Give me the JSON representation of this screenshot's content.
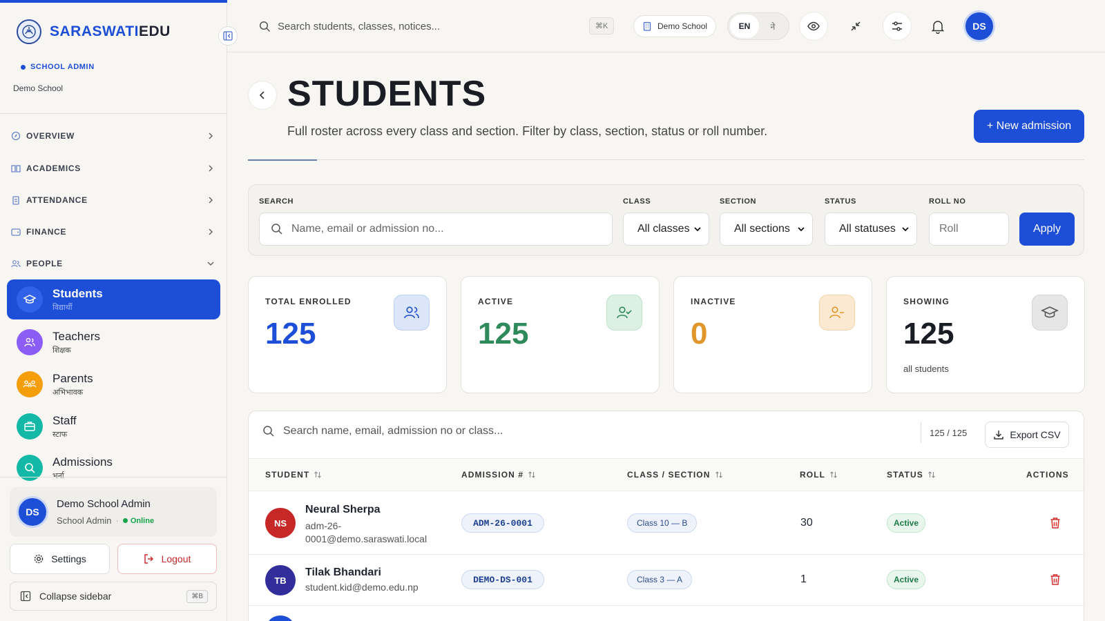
{
  "brand": {
    "part1": "SARASWATI",
    "part2": "EDU"
  },
  "sidebar": {
    "role": "SCHOOL ADMIN",
    "school": "Demo School",
    "groups": [
      {
        "label": "OVERVIEW"
      },
      {
        "label": "ACADEMICS"
      },
      {
        "label": "ATTENDANCE"
      },
      {
        "label": "FINANCE"
      },
      {
        "label": "PEOPLE"
      }
    ],
    "items": [
      {
        "label": "Students",
        "sub": "विद्यार्थी",
        "color": "#1d4ed8"
      },
      {
        "label": "Teachers",
        "sub": "शिक्षक",
        "color": "#8b5cf6"
      },
      {
        "label": "Parents",
        "sub": "अभिभावक",
        "color": "#f59e0b"
      },
      {
        "label": "Staff",
        "sub": "स्टाफ",
        "color": "#14b8a6"
      },
      {
        "label": "Admissions",
        "sub": "भर्ना",
        "color": "#14b8a6"
      }
    ],
    "user": {
      "initials": "DS",
      "name": "Demo School Admin",
      "role": "School Admin",
      "status": "Online"
    },
    "settings_label": "Settings",
    "logout_label": "Logout",
    "collapse_label": "Collapse sidebar",
    "collapse_kbd": "⌘B"
  },
  "topbar": {
    "search_placeholder": "Search students, classes, notices...",
    "search_kbd": "⌘K",
    "school_chip": "Demo School",
    "lang_active": "EN",
    "lang_other": "ने",
    "avatar": "DS"
  },
  "page": {
    "title": "STUDENTS",
    "subtitle": "Full roster across every class and section. Filter by class, section, status or roll number.",
    "new_button": "+ New admission"
  },
  "filters": {
    "search_label": "SEARCH",
    "search_placeholder": "Name, email or admission no...",
    "class_label": "CLASS",
    "class_value": "All classes",
    "section_label": "SECTION",
    "section_value": "All sections",
    "status_label": "STATUS",
    "status_value": "All statuses",
    "roll_label": "ROLL NO",
    "roll_placeholder": "Roll",
    "apply": "Apply"
  },
  "stats": [
    {
      "label": "TOTAL ENROLLED",
      "value": "125",
      "color": "#1d4ed8",
      "sub": ""
    },
    {
      "label": "ACTIVE",
      "value": "125",
      "color": "#2f8a5b",
      "sub": ""
    },
    {
      "label": "INACTIVE",
      "value": "0",
      "color": "#e0962a",
      "sub": ""
    },
    {
      "label": "SHOWING",
      "value": "125",
      "color": "#1a1d24",
      "sub": "all students"
    }
  ],
  "table": {
    "search_placeholder": "Search name, email, admission no or class...",
    "count": "125 / 125",
    "export": "Export CSV",
    "headers": {
      "student": "STUDENT",
      "admission": "ADMISSION #",
      "class": "CLASS / SECTION",
      "roll": "ROLL",
      "status": "STATUS",
      "actions": "ACTIONS"
    },
    "rows": [
      {
        "initials": "NS",
        "avatar_color": "#c62828",
        "name": "Neural Sherpa",
        "email_1": "adm-26-",
        "email_2": "0001@demo.saraswati.local",
        "admission": "ADM-26-0001",
        "class": "Class 10 — B",
        "roll": "30",
        "status": "Active"
      },
      {
        "initials": "TB",
        "avatar_color": "#312e9c",
        "name": "Tilak Bhandari",
        "email_1": "student.kid@demo.edu.np",
        "email_2": "",
        "admission": "DEMO-DS-001",
        "class": "Class 3 — A",
        "roll": "1",
        "status": "Active"
      }
    ]
  }
}
